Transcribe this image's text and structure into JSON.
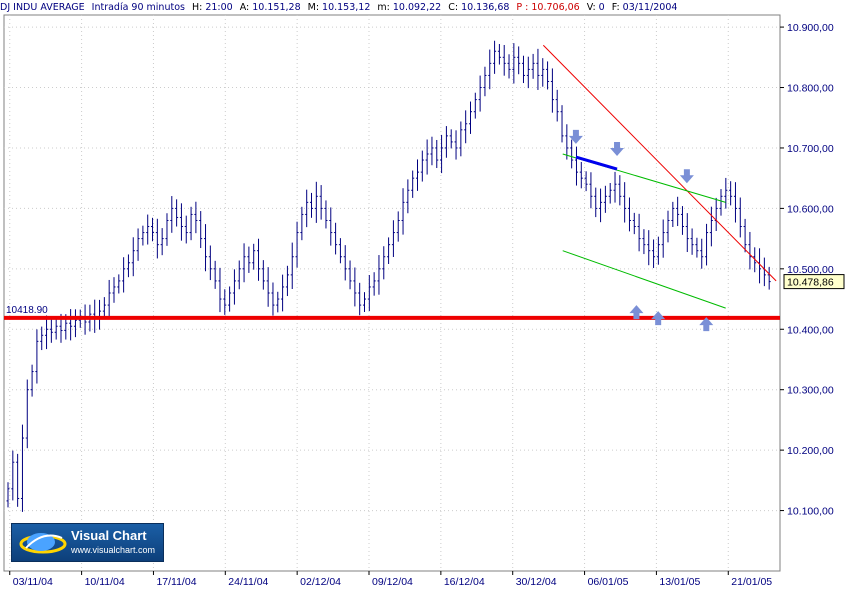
{
  "header": {
    "instrument": "DJ INDU AVERAGE",
    "interval": "Intradía 90 minutos",
    "fields": [
      {
        "label": "H:",
        "value": "21:00",
        "cls": "hdr-val"
      },
      {
        "label": "A:",
        "value": "10.151,28",
        "cls": "hdr-val"
      },
      {
        "label": "M:",
        "value": "10.153,12",
        "cls": "hdr-val"
      },
      {
        "label": "m:",
        "value": "10.092,22",
        "cls": "hdr-val"
      },
      {
        "label": "C:",
        "value": "10.136,68",
        "cls": "hdr-val"
      },
      {
        "label": "P :",
        "value": "10.706,06",
        "cls": "hdr-red"
      },
      {
        "label": "V:",
        "value": "0",
        "cls": "hdr-val"
      },
      {
        "label": "F:",
        "value": "03/11/2004",
        "cls": "hdr-val"
      }
    ]
  },
  "logo": {
    "title": "Visual Chart",
    "url": "www.visualchart.com"
  },
  "colors": {
    "bars": "#000080",
    "support": "#ee0000",
    "resistance": "#ee0000",
    "channel": "#00bb00",
    "wedge_top": "#0000ee",
    "arrows": "#7a8fd6",
    "grid": "#cccccc",
    "axis_text": "#000080",
    "last_price_box": "#ffffcc"
  },
  "chart_data": {
    "type": "ohlc",
    "title": "DJ INDU AVERAGE - Intradía 90 minutos",
    "ylim": [
      10000,
      10920
    ],
    "y_ticks": [
      "10.100,00",
      "10.200,00",
      "10.300,00",
      "10.400,00",
      "10.500,00",
      "10.600,00",
      "10.700,00",
      "10.800,00",
      "10.900,00"
    ],
    "y_tick_values": [
      10100,
      10200,
      10300,
      10400,
      10500,
      10600,
      10700,
      10800,
      10900
    ],
    "x_ticks": [
      "03/11/04",
      "10/11/04",
      "17/11/04",
      "24/11/04",
      "02/12/04",
      "09/12/04",
      "16/12/04",
      "30/12/04",
      "06/01/05",
      "13/01/05",
      "21/01/05"
    ],
    "grid": true,
    "last_price": 10478.86,
    "last_price_label": "10.478,86",
    "support_level": 10418.9,
    "support_label": "10418.90",
    "closes": [
      10136,
      10180,
      10120,
      10220,
      10300,
      10330,
      10380,
      10390,
      10400,
      10395,
      10405,
      10398,
      10410,
      10405,
      10415,
      10420,
      10412,
      10425,
      10418,
      10430,
      10440,
      10460,
      10470,
      10480,
      10500,
      10510,
      10530,
      10550,
      10560,
      10570,
      10560,
      10540,
      10550,
      10580,
      10600,
      10585,
      10570,
      10560,
      10590,
      10580,
      10550,
      10520,
      10500,
      10480,
      10450,
      10440,
      10460,
      10480,
      10500,
      10520,
      10510,
      10530,
      10500,
      10480,
      10460,
      10440,
      10450,
      10470,
      10490,
      10520,
      10560,
      10590,
      10610,
      10600,
      10620,
      10600,
      10580,
      10560,
      10540,
      10520,
      10500,
      10480,
      10460,
      10440,
      10450,
      10470,
      10480,
      10500,
      10520,
      10540,
      10560,
      10580,
      10610,
      10630,
      10650,
      10660,
      10680,
      10690,
      10700,
      10680,
      10700,
      10720,
      10710,
      10700,
      10730,
      10740,
      10760,
      10780,
      10800,
      10820,
      10840,
      10860,
      10850,
      10840,
      10830,
      10850,
      10840,
      10820,
      10830,
      10840,
      10820,
      10830,
      10810,
      10780,
      10760,
      10720,
      10700,
      10680,
      10660,
      10650,
      10640,
      10620,
      10600,
      10610,
      10620,
      10630,
      10640,
      10620,
      10600,
      10580,
      10570,
      10550,
      10540,
      10530,
      10520,
      10540,
      10560,
      10580,
      10600,
      10590,
      10570,
      10550,
      10540,
      10530,
      10520,
      10560,
      10580,
      10600,
      10620,
      10630,
      10620,
      10600,
      10570,
      10540,
      10520,
      10510,
      10500,
      10490,
      10478.86
    ],
    "series": [
      {
        "name": "DJ INDU AVERAGE",
        "kind": "ohlc"
      }
    ],
    "annotations": {
      "support_line": {
        "y": 10418.9
      },
      "resistance_line": {
        "from": {
          "x_frac": 0.695,
          "y": 10870
        },
        "to": {
          "x_frac": 0.995,
          "y": 10480
        }
      },
      "channel_upper": {
        "from": {
          "x_frac": 0.72,
          "y": 10690
        },
        "to": {
          "x_frac": 0.93,
          "y": 10610
        }
      },
      "channel_lower": {
        "from": {
          "x_frac": 0.72,
          "y": 10530
        },
        "to": {
          "x_frac": 0.93,
          "y": 10435
        }
      },
      "wedge_top": {
        "from": {
          "x_frac": 0.737,
          "y": 10685
        },
        "to": {
          "x_frac": 0.79,
          "y": 10665
        }
      },
      "down_arrows": [
        {
          "x_frac": 0.737,
          "y": 10710
        },
        {
          "x_frac": 0.79,
          "y": 10690
        },
        {
          "x_frac": 0.88,
          "y": 10645
        }
      ],
      "up_arrows": [
        {
          "x_frac": 0.815,
          "y": 10440
        },
        {
          "x_frac": 0.843,
          "y": 10430
        },
        {
          "x_frac": 0.905,
          "y": 10420
        }
      ]
    }
  }
}
